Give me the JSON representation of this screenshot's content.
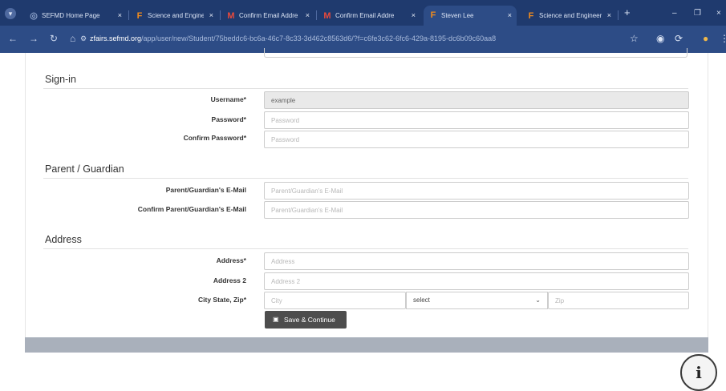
{
  "browser": {
    "tabs": [
      {
        "title": "SEFMD Home Page",
        "favicon": "globe-icon",
        "close": "×"
      },
      {
        "title": "Science and Engineer",
        "favicon": "F",
        "close": "×"
      },
      {
        "title": "Confirm Email Addre",
        "favicon": "M",
        "close": "×"
      },
      {
        "title": "Confirm Email Addre",
        "favicon": "M",
        "close": "×"
      },
      {
        "title": "Steven Lee",
        "favicon": "F",
        "close": "×"
      },
      {
        "title": "Science and Engineer",
        "favicon": "F",
        "close": "×"
      }
    ],
    "new_tab": "+",
    "minimize": "–",
    "restore": "❐",
    "close": "×",
    "url_host": "zfairs.sefmd.org",
    "url_path": "/app/user/new/Student/75beddc6-bc6a-46c7-8c33-3d462c8563d6/?f=c6fe3c62-6fc6-429a-8195-dc6b09c60aa8"
  },
  "signin": {
    "heading": "Sign-in",
    "username_label": "Username*",
    "username_value": "example",
    "password_label": "Password*",
    "password_placeholder": "Password",
    "confirm_label": "Confirm Password*",
    "confirm_placeholder": "Password"
  },
  "guardian": {
    "heading": "Parent / Guardian",
    "email_label": "Parent/Guardian's E-Mail",
    "email_placeholder": "Parent/Guardian's E-Mail",
    "confirm_label": "Confirm Parent/Guardian's E-Mail",
    "confirm_placeholder": "Parent/Guardian's E-Mail"
  },
  "address": {
    "heading": "Address",
    "address_label": "Address*",
    "address_placeholder": "Address",
    "address2_label": "Address 2",
    "address2_placeholder": "Address 2",
    "city_label": "City State, Zip*",
    "city_placeholder": "City",
    "state_value": "select",
    "zip_placeholder": "Zip"
  },
  "actions": {
    "save_label": "Save & Continue"
  },
  "info_label": "i"
}
